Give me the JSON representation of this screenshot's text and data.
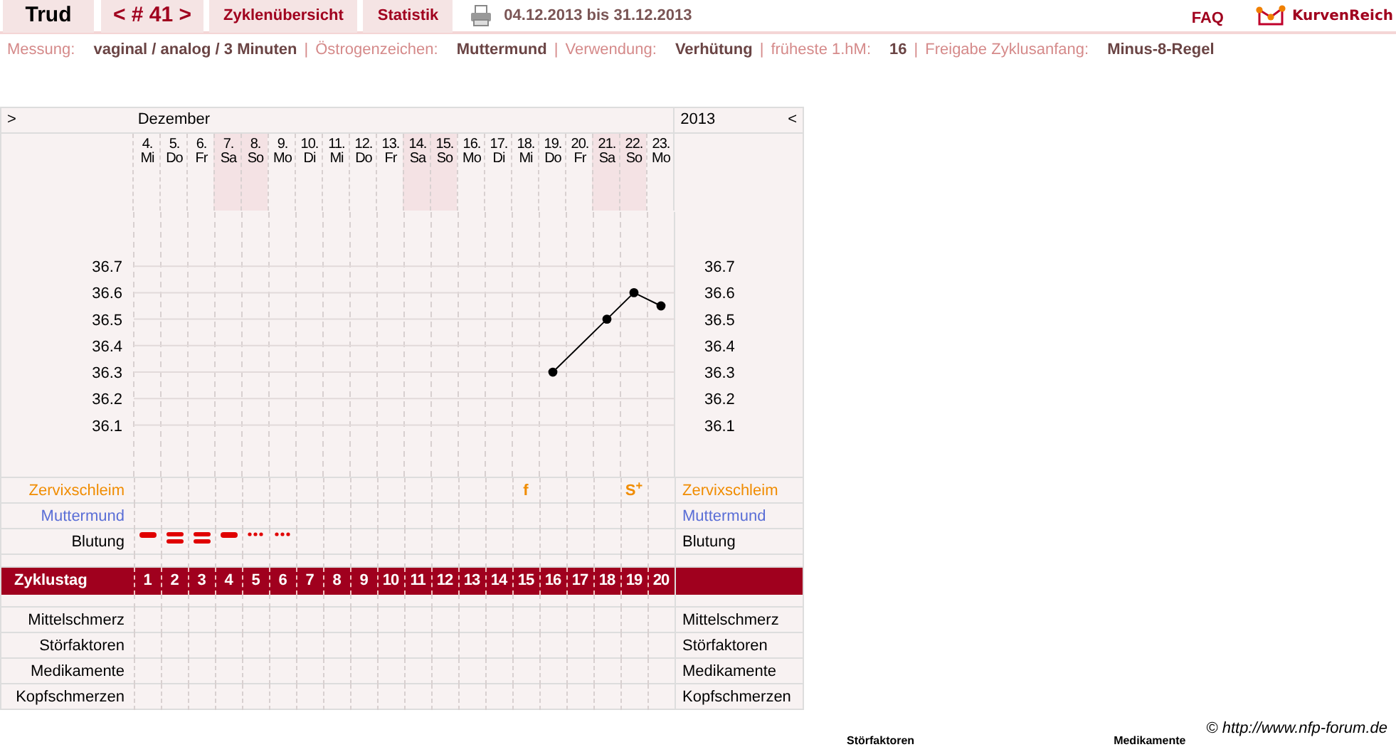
{
  "topbar": {
    "user": "Trud",
    "cycle_nav": "< # 41 >",
    "tabs": [
      {
        "label": "Zyklenübersicht",
        "selected": false
      },
      {
        "label": "Statistik",
        "selected": false
      }
    ],
    "date_range": "04.12.2013 bis 31.12.2013",
    "faq": "FAQ",
    "logo": "KurvenReich"
  },
  "info": {
    "separator": "|",
    "items": [
      {
        "label": "Messung:",
        "value": "vaginal / analog / 3 Minuten"
      },
      {
        "label": "Östrogenzeichen:",
        "value": "Muttermund"
      },
      {
        "label": "Verwendung:",
        "value": "Verhütung"
      },
      {
        "label": "früheste 1.hM:",
        "value": "16"
      },
      {
        "label": "Freigabe Zyklusanfang:",
        "value": "Minus-8-Regel"
      }
    ]
  },
  "chart": {
    "nav_next": ">",
    "month": "Dezember",
    "year": "2013",
    "nav_prev": "<",
    "days": [
      {
        "weekday": "Mi",
        "weekend": false,
        "bleeding": {
          "kind": "medium"
        }
      },
      {
        "weekday": "Do",
        "weekend": false,
        "bleeding": {
          "kind": "strong"
        }
      },
      {
        "weekday": "Fr",
        "weekend": false,
        "bleeding": {
          "kind": "strong"
        }
      },
      {
        "weekday": "Sa",
        "weekend": true,
        "bleeding": {
          "kind": "medium"
        }
      },
      {
        "weekday": "So",
        "weekend": true,
        "bleeding": {
          "kind": "spotting"
        }
      },
      {
        "weekday": "Mo",
        "weekend": false,
        "bleeding": {
          "kind": "spotting"
        }
      },
      {
        "weekday": "Di",
        "weekend": false
      },
      {
        "weekday": "Mi",
        "weekend": false
      },
      {
        "weekday": "Do",
        "weekend": false
      },
      {
        "weekday": "Fr",
        "weekend": false
      },
      {
        "weekday": "Sa",
        "weekend": true
      },
      {
        "weekday": "So",
        "weekend": true
      },
      {
        "weekday": "Mo",
        "weekend": false
      },
      {
        "weekday": "Di",
        "weekend": false
      },
      {
        "weekday": "Mi",
        "weekend": false,
        "mucus": "f"
      },
      {
        "weekday": "Do",
        "weekend": false
      },
      {
        "weekday": "Fr",
        "weekend": false
      },
      {
        "weekday": "Sa",
        "weekend": true
      },
      {
        "weekday": "So",
        "weekend": true,
        "mucus": "S$^{+}$"
      },
      {
        "weekday": "Mo",
        "weekend": false
      }
    ],
    "chart_data": {
      "type": "line",
      "categories": [
        "4.",
        "5.",
        "6.",
        "7.",
        "8.",
        "9.",
        "10.",
        "11.",
        "12.",
        "13.",
        "14.",
        "15.",
        "16.",
        "17.",
        "18.",
        "19.",
        "20.",
        "21.",
        "22.",
        "23."
      ],
      "ylim": [
        35.9,
        37.2
      ],
      "yticks": [
        36.1,
        36.2,
        36.3,
        36.4,
        36.5,
        36.6,
        36.7
      ],
      "grid": true,
      "series": [
        {
          "color": "#000000",
          "marker": "circle",
          "values": [
            null,
            null,
            null,
            null,
            null,
            null,
            null,
            null,
            null,
            null,
            null,
            null,
            null,
            null,
            null,
            36.3,
            null,
            36.5,
            36.6,
            36.55
          ]
        }
      ]
    },
    "right_axis_labels": [
      "36.7",
      "36.6",
      "36.5",
      "36.4",
      "36.3",
      "36.2",
      "36.1"
    ],
    "mucus_label": "Zervixschleim",
    "mucus_right_label": "Zervixschleim",
    "cervix_label": "Muttermund",
    "cervix_right_label": "Muttermund",
    "bleeding_label": "Blutung",
    "bleeding_right_label": "Blutung",
    "cycle_day": {
      "label": "Zyklustag",
      "numbers": [
        "1",
        "2",
        "3",
        "4",
        "5",
        "6",
        "7",
        "8",
        "9",
        "10",
        "11",
        "12",
        "13",
        "14",
        "15",
        "16",
        "17",
        "18",
        "19",
        "20"
      ]
    },
    "symptom_rows": [
      {
        "label": "Mittelschmerz",
        "right_label": "Mittelschmerz"
      },
      {
        "label": "Störfaktoren",
        "right_label": "Störfaktoren"
      },
      {
        "label": "Medikamente",
        "right_label": "Medikamente"
      },
      {
        "label": "Kopfschmerzen",
        "right_label": "Kopfschmerzen"
      }
    ]
  },
  "copyright": "© http://www.nfp-forum.de",
  "footer_labels": [
    "Störfaktoren",
    "Medikamente"
  ]
}
